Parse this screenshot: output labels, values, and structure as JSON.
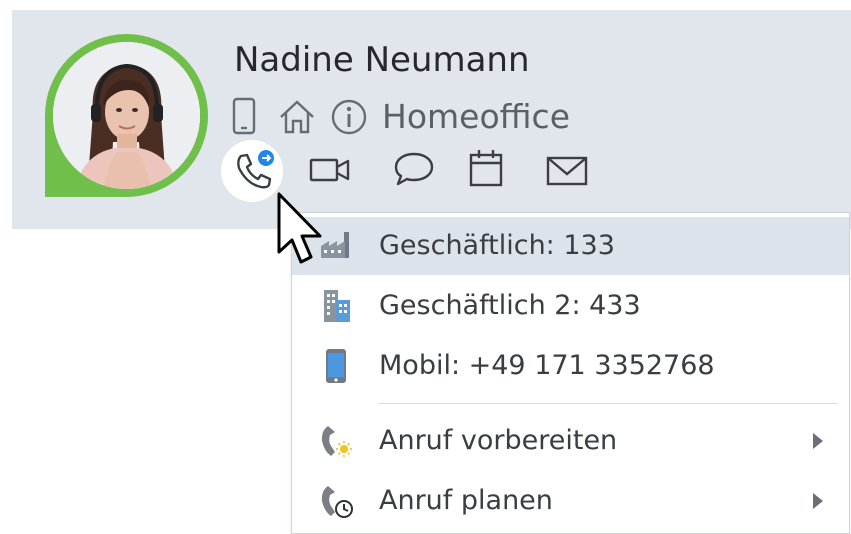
{
  "contact": {
    "name": "Nadine Neumann",
    "status_text": "Homeoffice",
    "avatar_ring_color": "#6fbf4a"
  },
  "status_icons": [
    "mobile-device-icon",
    "home-icon",
    "info-icon"
  ],
  "actions": [
    {
      "name": "call-icon",
      "active": true
    },
    {
      "name": "video-call-icon"
    },
    {
      "name": "chat-icon"
    },
    {
      "name": "calendar-icon"
    },
    {
      "name": "email-icon"
    }
  ],
  "menu": {
    "items": [
      {
        "label": "Geschäftlich: 133",
        "icon": "factory-icon",
        "highlighted": true
      },
      {
        "label": "Geschäftlich 2: 433",
        "icon": "office-building-icon"
      },
      {
        "label": "Mobil: +49 171 3352768",
        "icon": "smartphone-icon"
      },
      {
        "label": "Anruf vorbereiten",
        "icon": "phone-prepare-icon",
        "submenu": true
      },
      {
        "label": "Anruf planen",
        "icon": "phone-schedule-icon",
        "submenu": true
      }
    ]
  },
  "colors": {
    "header_bg": "#e1e6ec",
    "highlight_bg": "#dde3ea",
    "accent_blue": "#1e88e5"
  }
}
